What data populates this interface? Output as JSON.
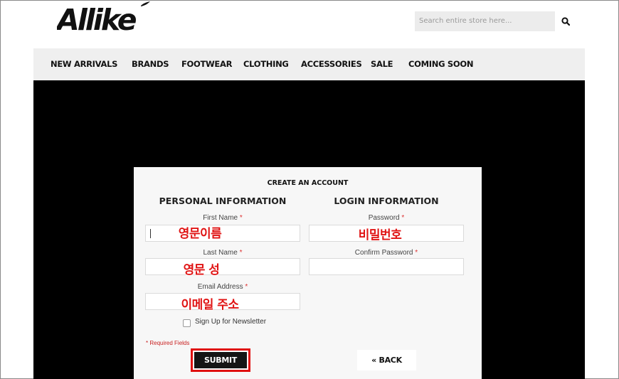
{
  "brand": {
    "logo_text": "Allike"
  },
  "header": {
    "search_placeholder": "Search entire store here..."
  },
  "nav": {
    "items": [
      "NEW ARRIVALS",
      "BRANDS",
      "FOOTWEAR",
      "CLOTHING",
      "ACCESSORIES",
      "SALE",
      "COMING SOON"
    ]
  },
  "form": {
    "title": "CREATE AN ACCOUNT",
    "personal_heading": "PERSONAL INFORMATION",
    "login_heading": "LOGIN INFORMATION",
    "required_mark": "*",
    "first_name_label": "First Name",
    "last_name_label": "Last Name",
    "email_label": "Email Address",
    "password_label": "Password",
    "confirm_password_label": "Confirm Password",
    "newsletter_label": "Sign Up for Newsletter",
    "required_note": "* Required Fields",
    "submit_label": "SUBMIT",
    "back_label": "« BACK"
  },
  "annotations": {
    "first_name": "영문이름",
    "last_name": "영문 성",
    "email": "이메일 주소",
    "password": "비밀번호"
  },
  "colors": {
    "annotation_red": "#e01414",
    "nav_bg": "#efefef",
    "hero_bg": "#000000",
    "button_dark": "#151515"
  }
}
